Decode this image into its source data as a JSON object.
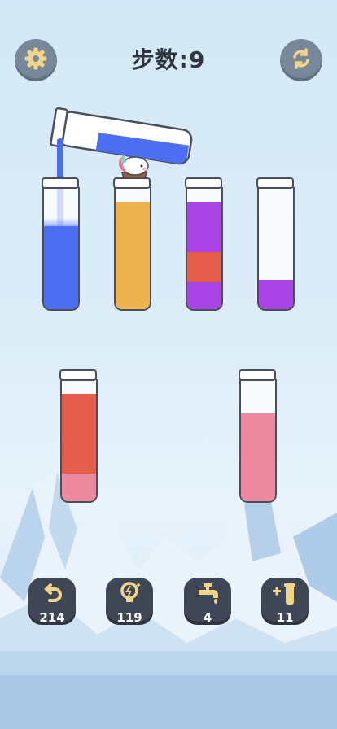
{
  "header": {
    "moves_label": "步数:9"
  },
  "icons": {
    "settings": "gear-icon",
    "restart": "refresh-icon",
    "undo": "undo-icon",
    "hint": "lightbulb-icon",
    "faucet": "faucet-icon",
    "add_tube": "add-tube-icon"
  },
  "colors": {
    "blue": "#4b6ff0",
    "orange": "#edb351",
    "purple": "#a843e6",
    "red": "#e55e4b",
    "pink": "#ee8aa0",
    "tool_bg": "#3f4656",
    "button_bg": "#77889a"
  },
  "tubes": [
    {
      "id": "tube-1",
      "layers_bottom_to_top": [
        "blue",
        "blue",
        "blue"
      ],
      "fill_levels": 3
    },
    {
      "id": "tube-2",
      "layers_bottom_to_top": [
        "orange",
        "orange",
        "orange",
        "orange"
      ],
      "fill_levels": 4
    },
    {
      "id": "tube-3",
      "layers_bottom_to_top": [
        "purple",
        "red",
        "purple",
        "purple"
      ],
      "fill_levels": 4
    },
    {
      "id": "tube-4",
      "layers_bottom_to_top": [
        "purple"
      ],
      "fill_levels": 1
    },
    {
      "id": "tube-5",
      "layers_bottom_to_top": [
        "pink",
        "red",
        "red",
        "red"
      ],
      "fill_levels": 4
    },
    {
      "id": "tube-6",
      "layers_bottom_to_top": [
        "pink",
        "pink",
        "pink"
      ],
      "fill_levels": 3
    }
  ],
  "pouring": {
    "from_color": "blue",
    "into": "tube-1"
  },
  "tools": [
    {
      "name": "undo",
      "count": "214"
    },
    {
      "name": "hint",
      "count": "119"
    },
    {
      "name": "faucet",
      "count": "4"
    },
    {
      "name": "add-tube",
      "count": "11"
    }
  ]
}
